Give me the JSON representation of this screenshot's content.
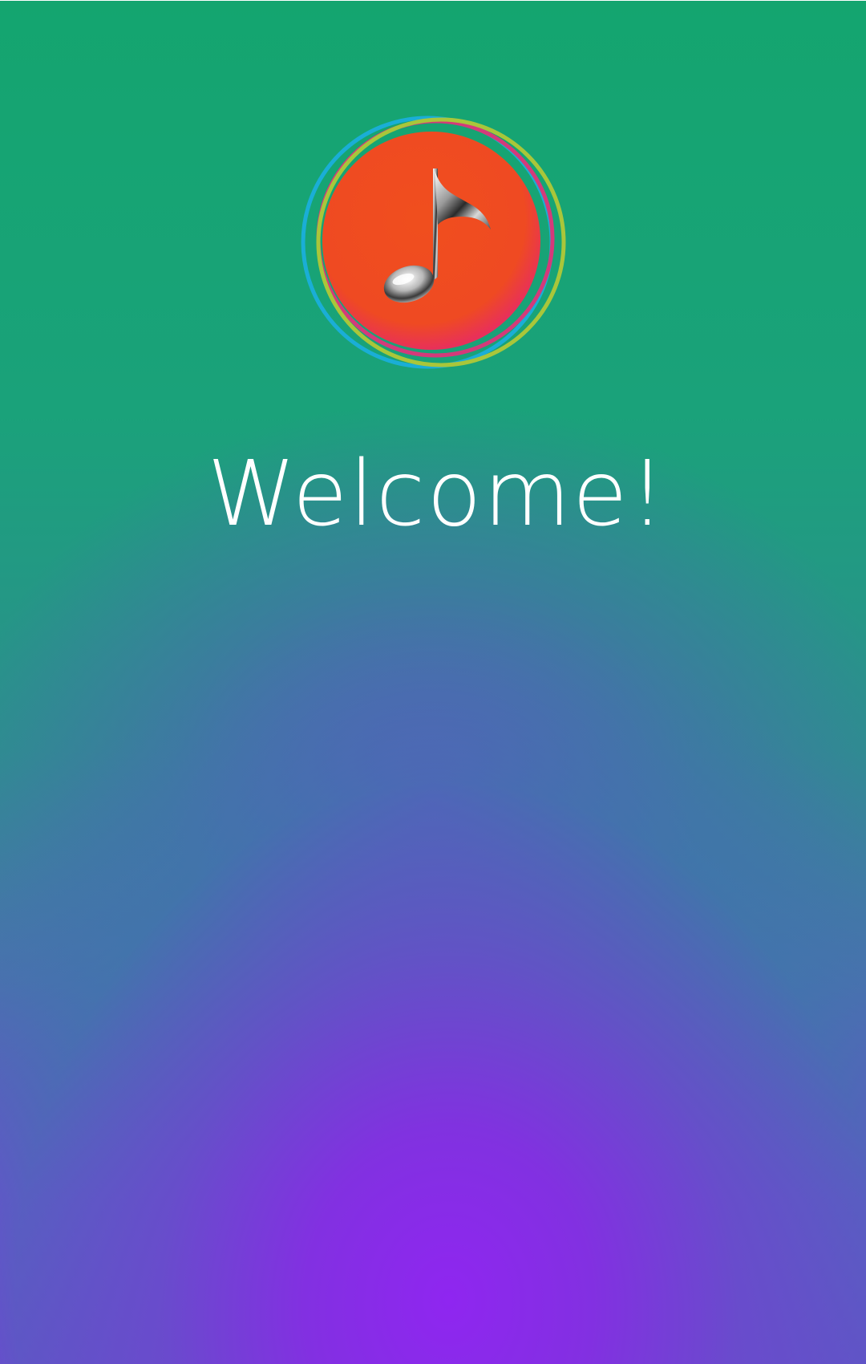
{
  "screen": {
    "welcome_text": "Welcome!"
  },
  "logo": {
    "icon": "music-note-icon",
    "disc_color": "#ef4b21",
    "ring_colors": [
      "#1aaed6",
      "#d43a7a",
      "#a9c63a"
    ]
  },
  "colors": {
    "top_green": "#0fa968",
    "bottom_purple": "#8e28ee",
    "text": "#ffffff"
  }
}
